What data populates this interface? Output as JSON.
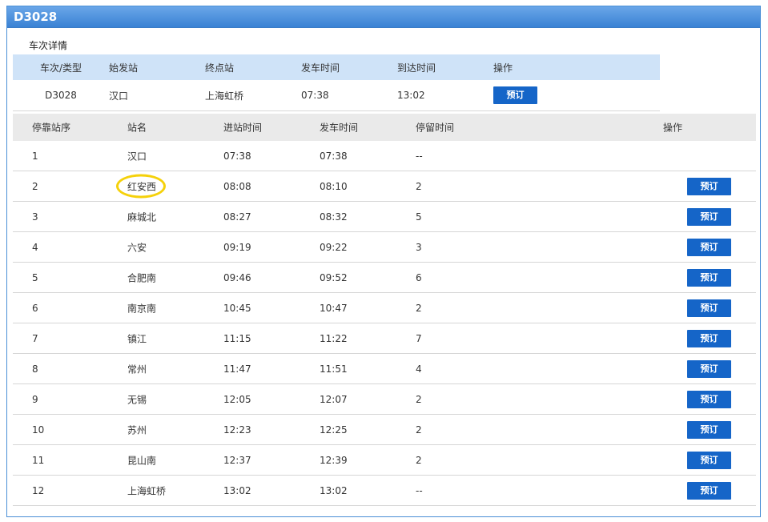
{
  "panel": {
    "title": "D3028"
  },
  "summary": {
    "section_label": "车次详情",
    "headers": [
      "车次/类型",
      "始发站",
      "终点站",
      "发车时间",
      "到达时间",
      "操作"
    ],
    "row": {
      "train": "D3028",
      "origin": "汉口",
      "destination": "上海虹桥",
      "depart": "07:38",
      "arrive": "13:02",
      "book_label": "预订"
    }
  },
  "stops": {
    "headers": [
      "停靠站序",
      "站名",
      "进站时间",
      "发车时间",
      "停留时间",
      "操作"
    ],
    "book_label": "预订",
    "rows": [
      {
        "seq": "1",
        "station": "汉口",
        "arrive": "07:38",
        "depart": "07:38",
        "stay": "--",
        "bookable": false
      },
      {
        "seq": "2",
        "station": "红安西",
        "arrive": "08:08",
        "depart": "08:10",
        "stay": "2",
        "bookable": true,
        "highlighted": true
      },
      {
        "seq": "3",
        "station": "麻城北",
        "arrive": "08:27",
        "depart": "08:32",
        "stay": "5",
        "bookable": true
      },
      {
        "seq": "4",
        "station": "六安",
        "arrive": "09:19",
        "depart": "09:22",
        "stay": "3",
        "bookable": true
      },
      {
        "seq": "5",
        "station": "合肥南",
        "arrive": "09:46",
        "depart": "09:52",
        "stay": "6",
        "bookable": true
      },
      {
        "seq": "6",
        "station": "南京南",
        "arrive": "10:45",
        "depart": "10:47",
        "stay": "2",
        "bookable": true
      },
      {
        "seq": "7",
        "station": "镇江",
        "arrive": "11:15",
        "depart": "11:22",
        "stay": "7",
        "bookable": true
      },
      {
        "seq": "8",
        "station": "常州",
        "arrive": "11:47",
        "depart": "11:51",
        "stay": "4",
        "bookable": true
      },
      {
        "seq": "9",
        "station": "无锡",
        "arrive": "12:05",
        "depart": "12:07",
        "stay": "2",
        "bookable": true
      },
      {
        "seq": "10",
        "station": "苏州",
        "arrive": "12:23",
        "depart": "12:25",
        "stay": "2",
        "bookable": true
      },
      {
        "seq": "11",
        "station": "昆山南",
        "arrive": "12:37",
        "depart": "12:39",
        "stay": "2",
        "bookable": true
      },
      {
        "seq": "12",
        "station": "上海虹桥",
        "arrive": "13:02",
        "depart": "13:02",
        "stay": "--",
        "bookable": true
      }
    ]
  },
  "colors": {
    "accent": "#1565c8",
    "highlight": "#f5d10a",
    "header_blue": "#cfe3f8"
  }
}
